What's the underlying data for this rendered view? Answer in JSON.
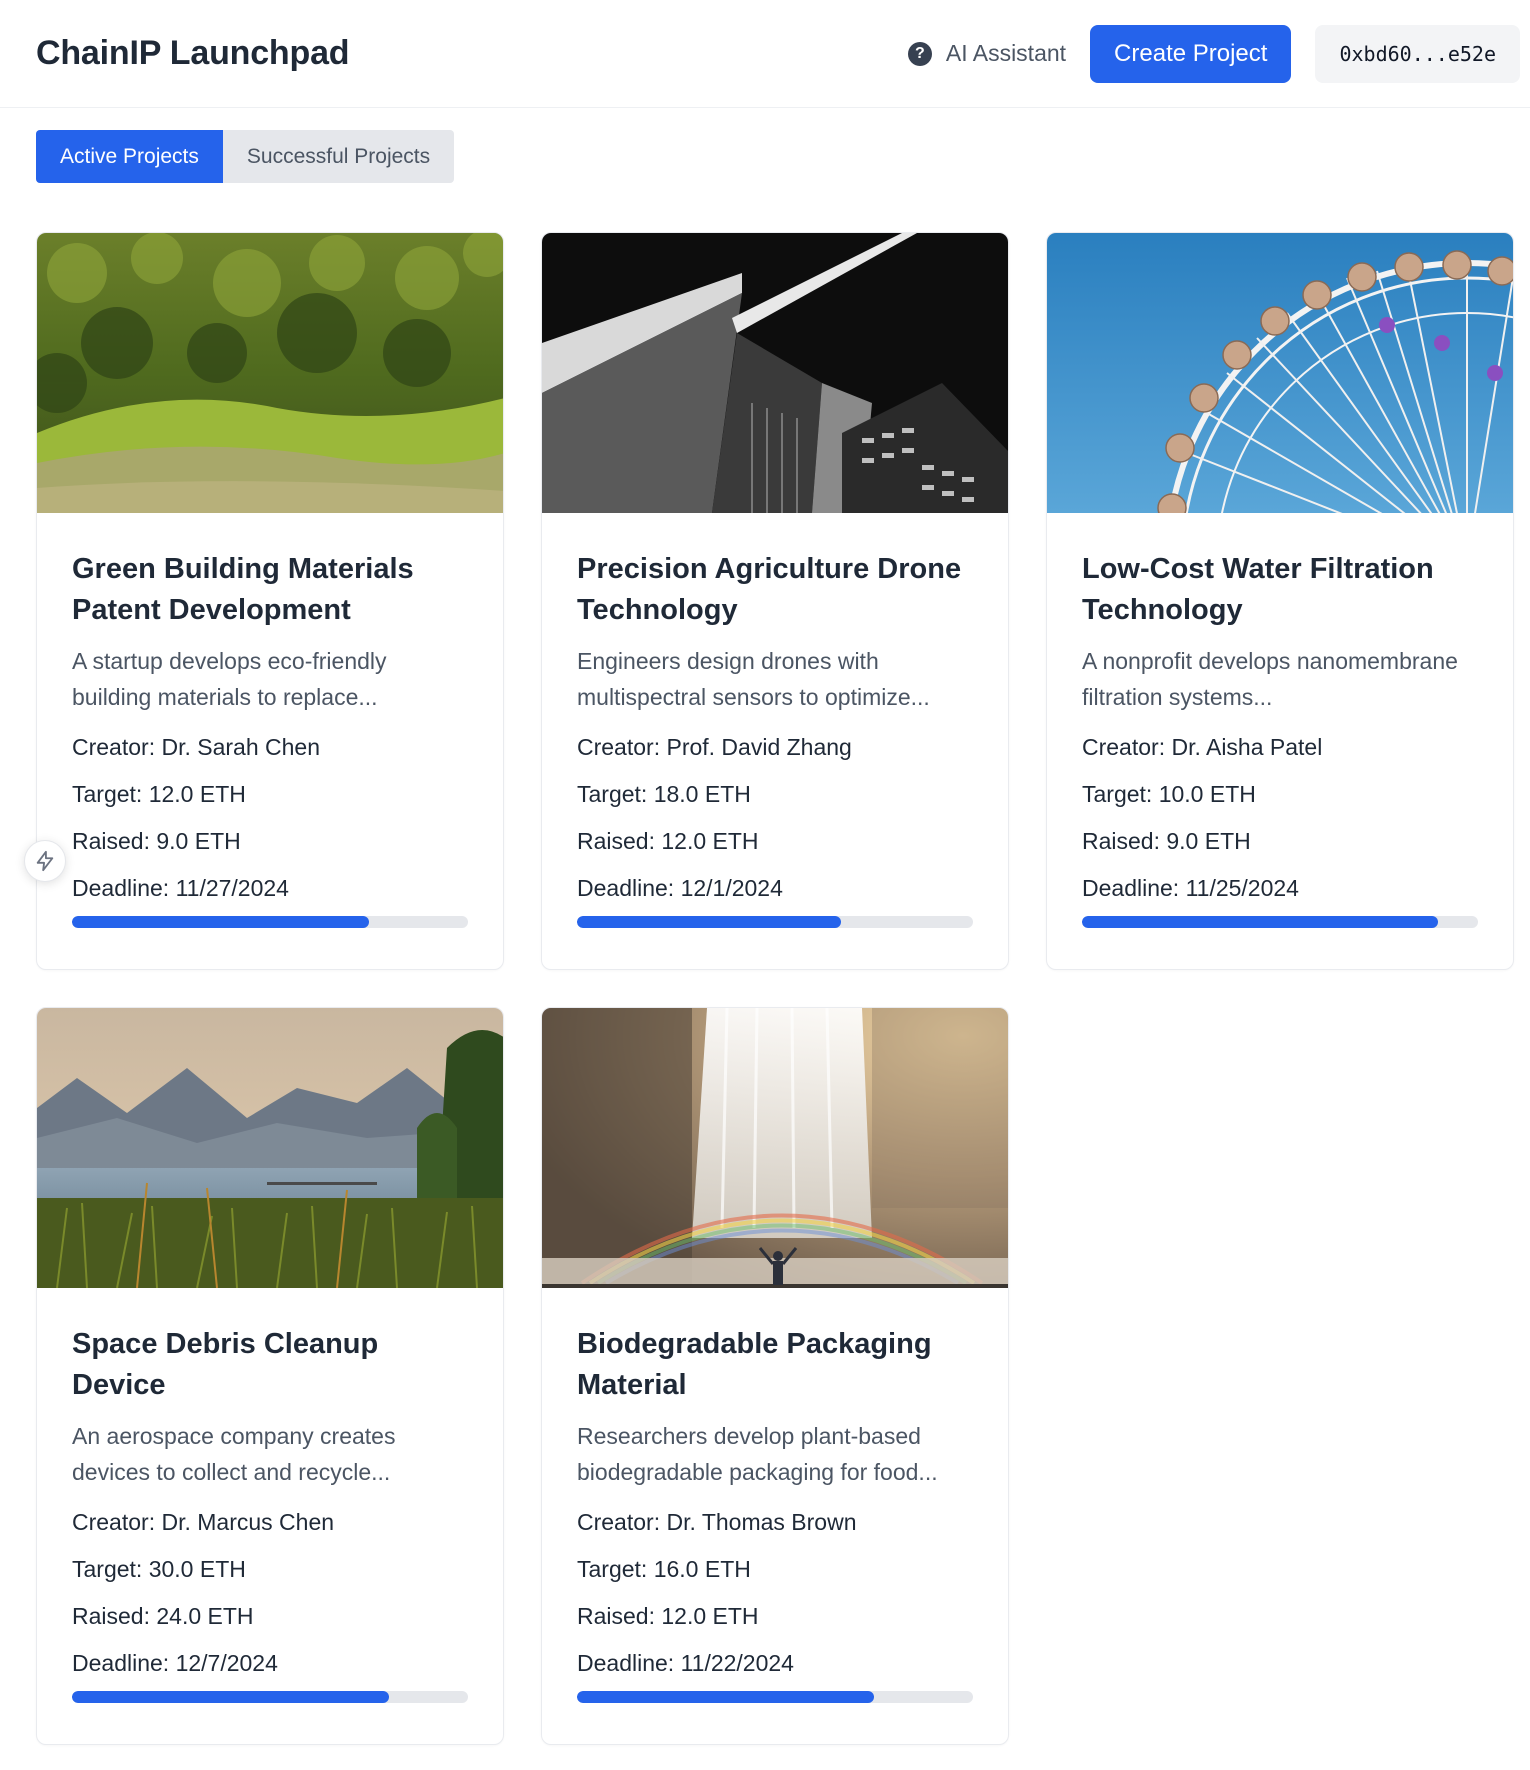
{
  "header": {
    "brand": "ChainIP Launchpad",
    "assistant_label": "AI Assistant",
    "help_glyph": "?",
    "create_label": "Create Project",
    "wallet": "0xbd60...e52e"
  },
  "tabs": [
    {
      "label": "Active Projects",
      "active": true
    },
    {
      "label": "Successful Projects",
      "active": false
    }
  ],
  "colors": {
    "accent": "#2563eb",
    "track": "#e5e7eb"
  },
  "projects": [
    {
      "title": "Green Building Materials Patent Development",
      "description": "A startup develops eco-friendly building materials to replace...",
      "creator": "Creator: Dr. Sarah Chen",
      "target": "Target: 12.0 ETH",
      "raised": "Raised: 9.0 ETH",
      "deadline": "Deadline: 11/27/2024",
      "progress": 0.75
    },
    {
      "title": "Precision Agriculture Drone Technology",
      "description": "Engineers design drones with multispectral sensors to optimize...",
      "creator": "Creator: Prof. David Zhang",
      "target": "Target: 18.0 ETH",
      "raised": "Raised: 12.0 ETH",
      "deadline": "Deadline: 12/1/2024",
      "progress": 0.667
    },
    {
      "title": "Low-Cost Water Filtration Technology",
      "description": "A nonprofit develops nanomembrane filtration systems...",
      "creator": "Creator: Dr. Aisha Patel",
      "target": "Target: 10.0 ETH",
      "raised": "Raised: 9.0 ETH",
      "deadline": "Deadline: 11/25/2024",
      "progress": 0.9
    },
    {
      "title": "Space Debris Cleanup Device",
      "description": "An aerospace company creates devices to collect and recycle...",
      "creator": "Creator: Dr. Marcus Chen",
      "target": "Target: 30.0 ETH",
      "raised": "Raised: 24.0 ETH",
      "deadline": "Deadline: 12/7/2024",
      "progress": 0.8
    },
    {
      "title": "Biodegradable Packaging Material",
      "description": "Researchers develop plant-based biodegradable packaging for food...",
      "creator": "Creator: Dr. Thomas Brown",
      "target": "Target: 16.0 ETH",
      "raised": "Raised: 12.0 ETH",
      "deadline": "Deadline: 11/22/2024",
      "progress": 0.75
    }
  ]
}
